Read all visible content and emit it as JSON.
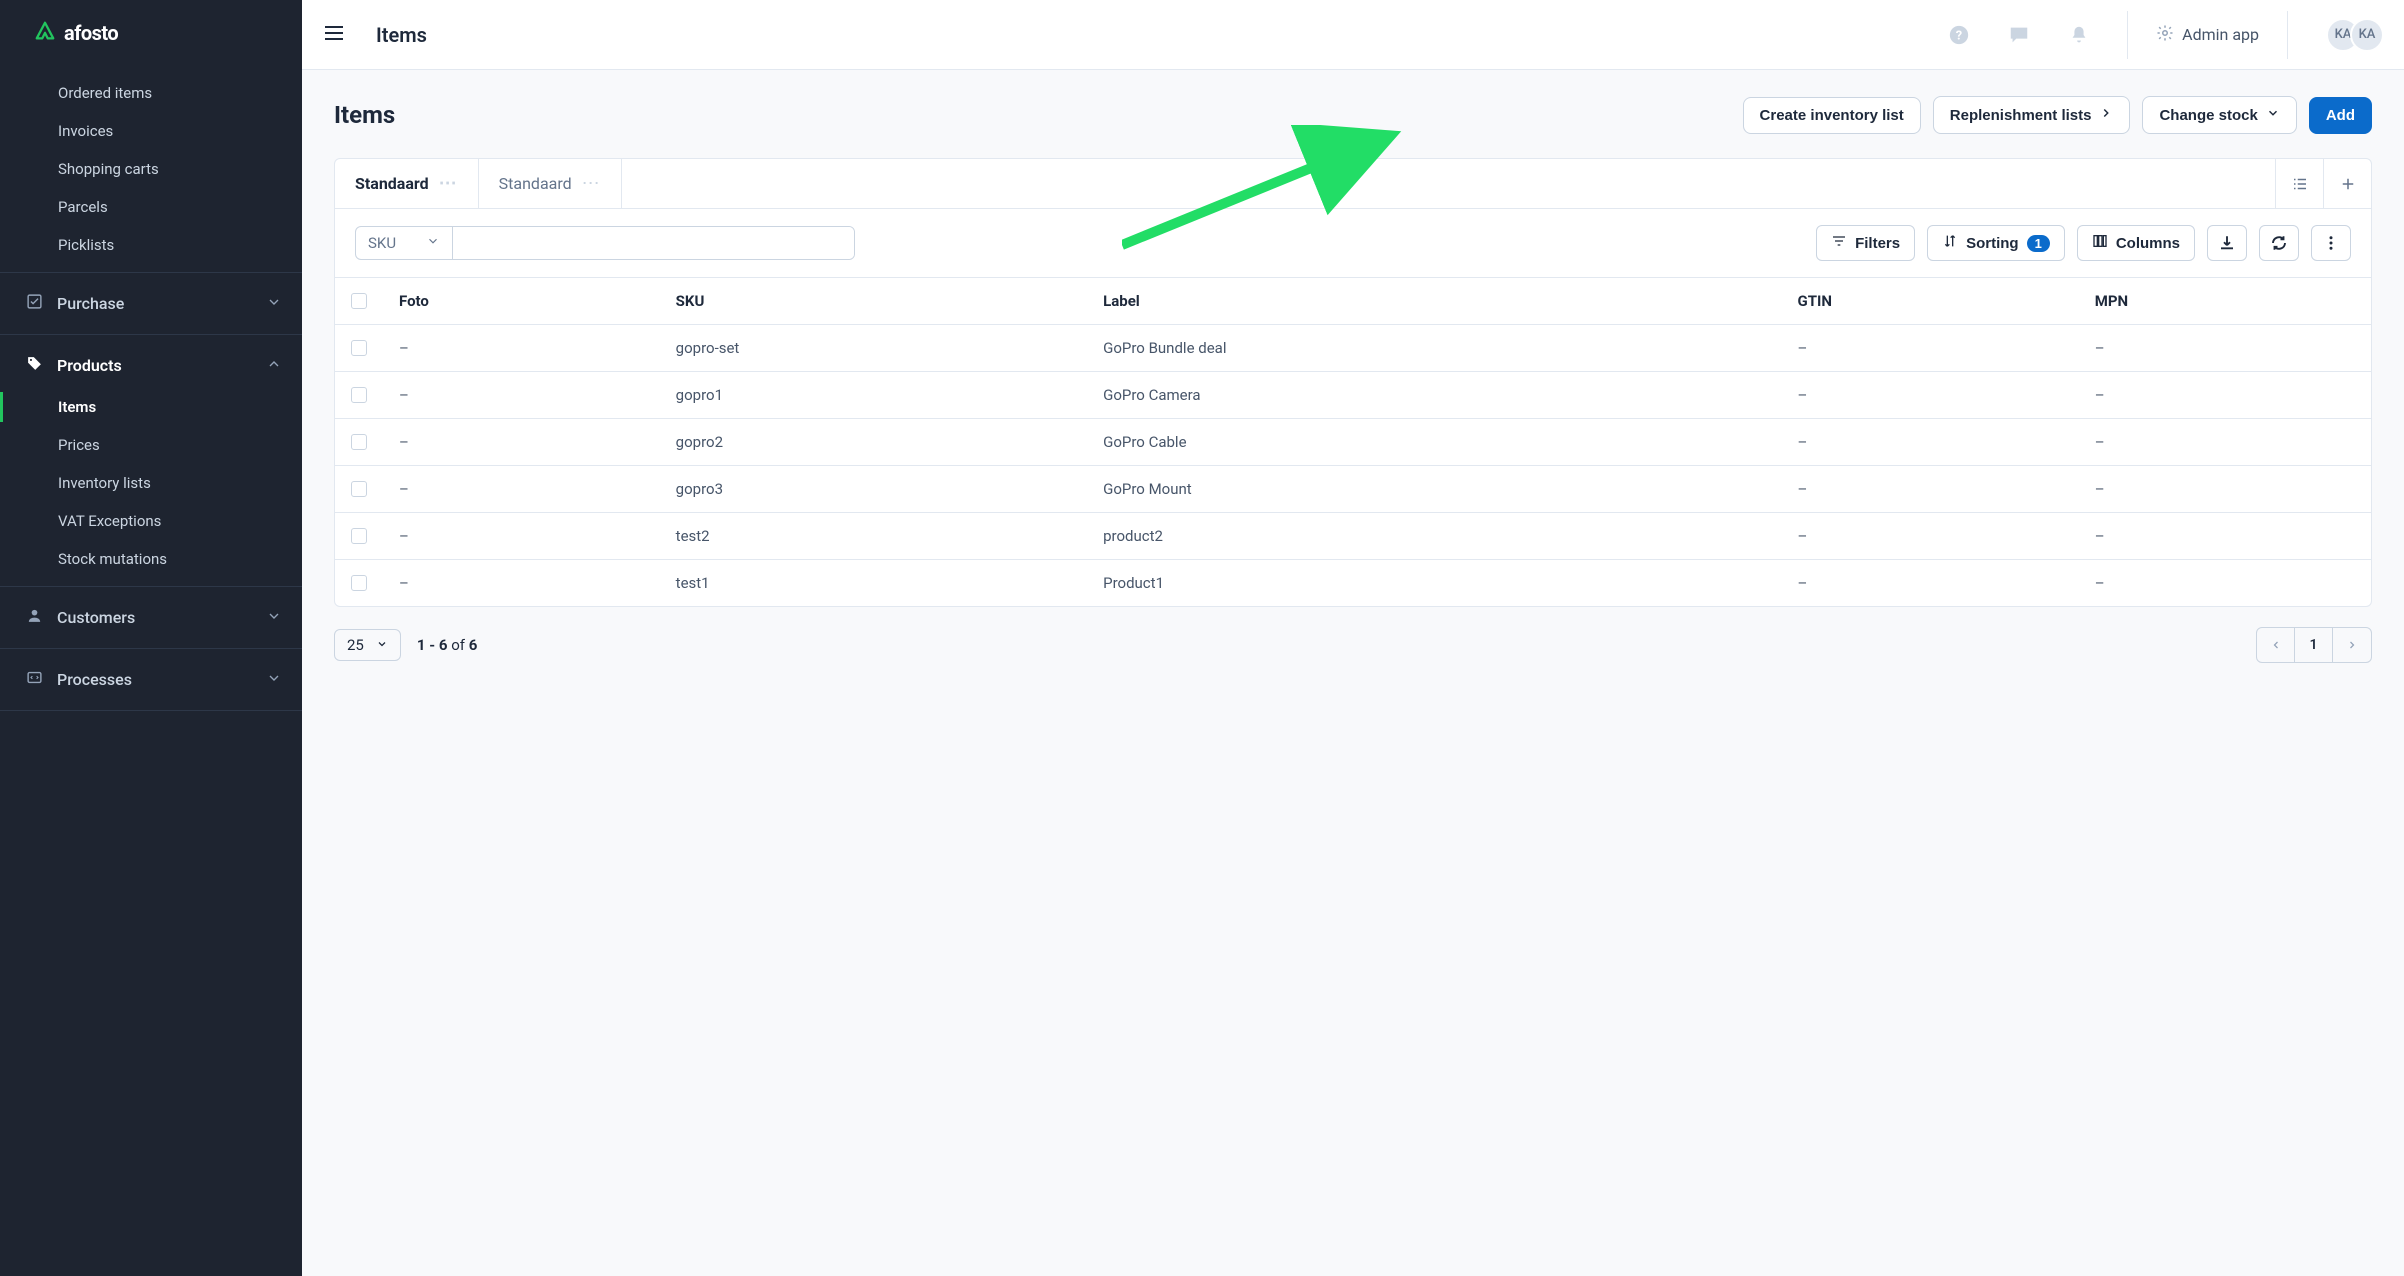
{
  "brand": "afosto",
  "topbar": {
    "title": "Items",
    "admin_label": "Admin app",
    "avatar_initials": "KA"
  },
  "sidebar": {
    "top_items": [
      "Ordered items",
      "Invoices",
      "Shopping carts",
      "Parcels",
      "Picklists"
    ],
    "purchase_label": "Purchase",
    "products_label": "Products",
    "products_children": [
      "Items",
      "Prices",
      "Inventory lists",
      "VAT Exceptions",
      "Stock mutations"
    ],
    "customers_label": "Customers",
    "processes_label": "Processes"
  },
  "page": {
    "title": "Items",
    "create_inventory": "Create inventory list",
    "replenishment": "Replenishment lists",
    "change_stock": "Change stock",
    "add": "Add"
  },
  "tabs": {
    "active": "Standaard",
    "inactive": "Standaard"
  },
  "toolbar": {
    "sku_label": "SKU",
    "filters": "Filters",
    "sorting": "Sorting",
    "sorting_count": "1",
    "columns": "Columns"
  },
  "table": {
    "headers": {
      "foto": "Foto",
      "sku": "SKU",
      "label": "Label",
      "gtin": "GTIN",
      "mpn": "MPN"
    },
    "rows": [
      {
        "foto": "–",
        "sku": "gopro-set",
        "label": "GoPro Bundle deal",
        "gtin": "–",
        "mpn": "–"
      },
      {
        "foto": "–",
        "sku": "gopro1",
        "label": "GoPro Camera",
        "gtin": "–",
        "mpn": "–"
      },
      {
        "foto": "–",
        "sku": "gopro2",
        "label": "GoPro Cable",
        "gtin": "–",
        "mpn": "–"
      },
      {
        "foto": "–",
        "sku": "gopro3",
        "label": "GoPro Mount",
        "gtin": "–",
        "mpn": "–"
      },
      {
        "foto": "–",
        "sku": "test2",
        "label": "product2",
        "gtin": "–",
        "mpn": "–"
      },
      {
        "foto": "–",
        "sku": "test1",
        "label": "Product1",
        "gtin": "–",
        "mpn": "–"
      }
    ]
  },
  "footer": {
    "page_size": "25",
    "range_a": "1 - 6",
    "range_of": "of",
    "range_total": "6",
    "current_page": "1"
  }
}
